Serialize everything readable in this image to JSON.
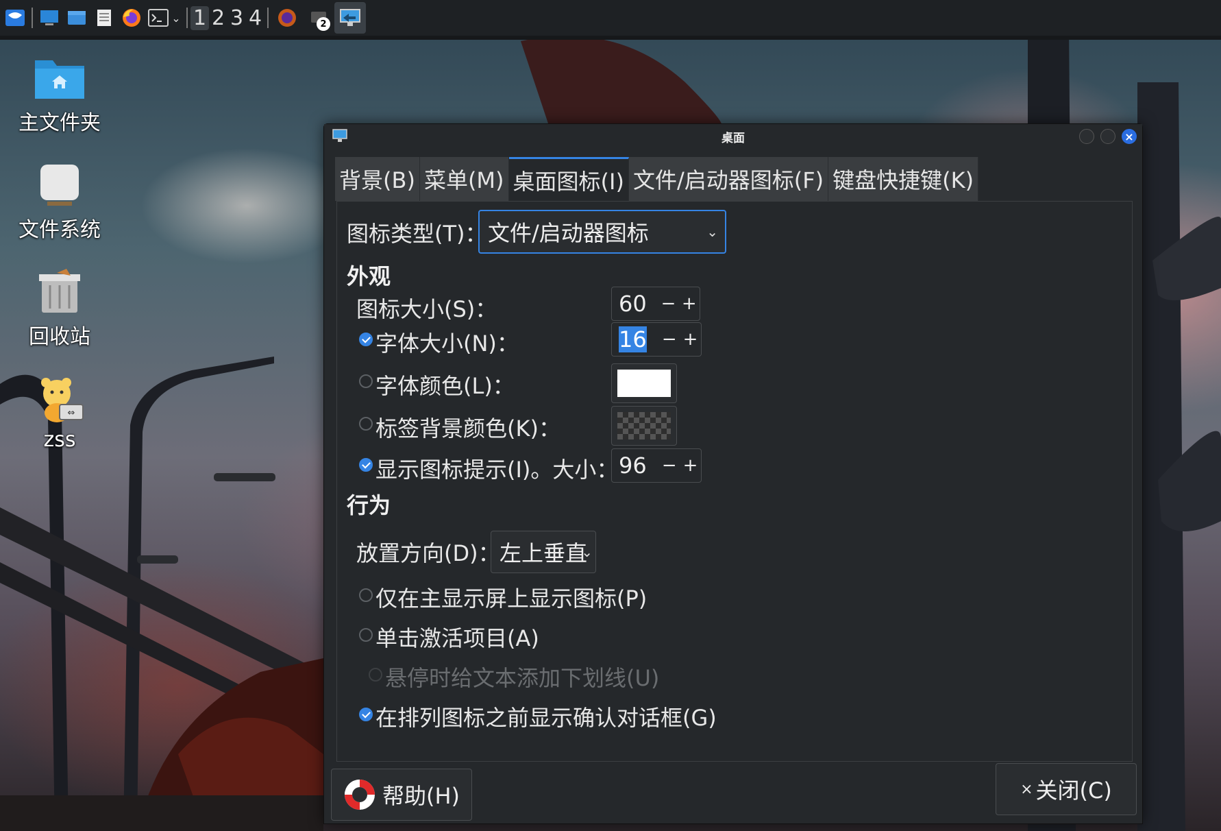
{
  "taskbar": {
    "workspaces": [
      "1",
      "2",
      "3",
      "4"
    ],
    "active_workspace": "1",
    "task_badge": "2"
  },
  "desktop_icons": [
    {
      "label": "主文件夹",
      "icon": "home-folder-icon"
    },
    {
      "label": "文件系统",
      "icon": "drive-icon"
    },
    {
      "label": "回收站",
      "icon": "trash-icon"
    },
    {
      "label": "zss",
      "icon": "user-launcher-icon"
    }
  ],
  "dialog": {
    "title": "桌面",
    "tabs": [
      {
        "label": "背景(B)",
        "active": false
      },
      {
        "label": "菜单(M)",
        "active": false
      },
      {
        "label": "桌面图标(I)",
        "active": true
      },
      {
        "label": "文件/启动器图标(F)",
        "active": false
      },
      {
        "label": "键盘快捷键(K)",
        "active": false
      }
    ],
    "icon_type": {
      "label": "图标类型(T)：",
      "value": "文件/启动器图标"
    },
    "appearance": {
      "heading": "外观",
      "icon_size": {
        "label": "图标大小(S)：",
        "value": "60"
      },
      "font_size": {
        "label": "字体大小(N)：",
        "value": "16",
        "checked": true
      },
      "font_color": {
        "label": "字体颜色(L)：",
        "checked": false,
        "color": "#ffffff"
      },
      "label_bg_color": {
        "label": "标签背景颜色(K)：",
        "checked": false
      },
      "show_tooltip": {
        "label": "显示图标提示(I)。大小：",
        "value": "96",
        "checked": true
      }
    },
    "behavior": {
      "heading": "行为",
      "placement": {
        "label": "放置方向(D)：",
        "value": "左上垂直"
      },
      "primary_only": {
        "label": "仅在主显示屏上显示图标(P)",
        "checked": false
      },
      "single_click": {
        "label": "单击激活项目(A)",
        "checked": false
      },
      "underline_hover": {
        "label": "悬停时给文本添加下划线(U)",
        "checked": false,
        "disabled": true
      },
      "confirm_arrange": {
        "label": "在排列图标之前显示确认对话框(G)",
        "checked": true
      }
    },
    "footer": {
      "help": "帮助(H)",
      "close": "关闭(C)"
    }
  },
  "minus": "−",
  "plus": "+",
  "colors": {
    "accent": "#3584e4",
    "annotation_arrow": "#e02020"
  }
}
